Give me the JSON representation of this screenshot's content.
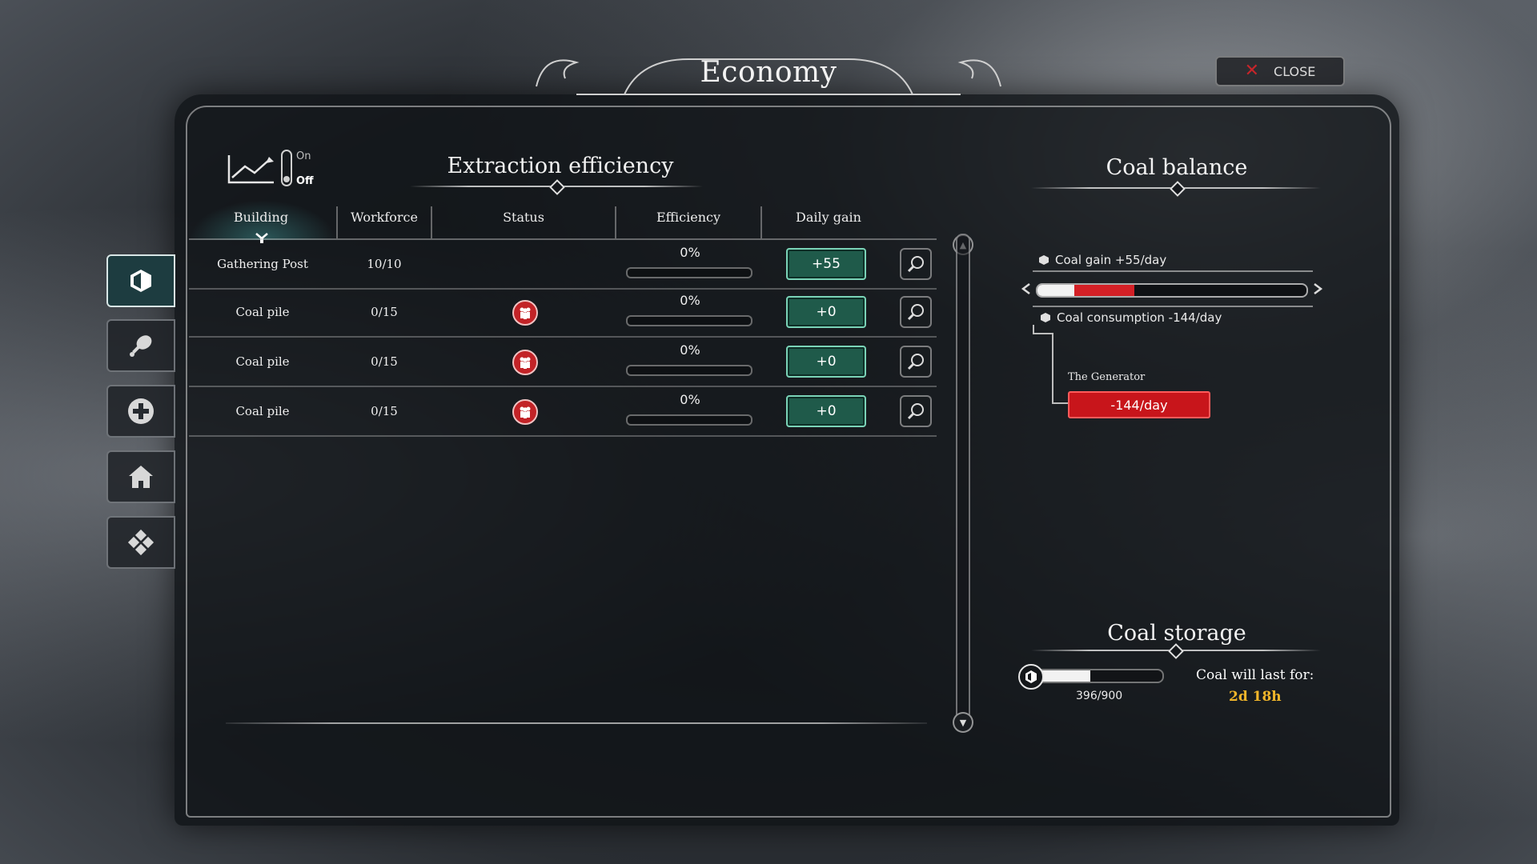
{
  "window": {
    "title": "Economy",
    "close_label": "CLOSE"
  },
  "side_tabs": [
    {
      "icon": "coal-icon",
      "active": true
    },
    {
      "icon": "meat-icon",
      "active": false
    },
    {
      "icon": "health-icon",
      "active": false
    },
    {
      "icon": "house-icon",
      "active": false
    },
    {
      "icon": "resources-icon",
      "active": false
    }
  ],
  "graph_toggle": {
    "on_label": "On",
    "off_label": "Off",
    "state": "off"
  },
  "extraction": {
    "title": "Extraction efficiency",
    "columns": [
      "Building",
      "Workforce",
      "Status",
      "Efficiency",
      "Daily gain"
    ],
    "rows": [
      {
        "building": "Gathering Post",
        "workforce": "10/10",
        "status": "",
        "efficiency": "0%",
        "efficiency_fraction": 0,
        "daily_gain": "+55"
      },
      {
        "building": "Coal pile",
        "workforce": "0/15",
        "status": "no-workers",
        "efficiency": "0%",
        "efficiency_fraction": 0,
        "daily_gain": "+0"
      },
      {
        "building": "Coal pile",
        "workforce": "0/15",
        "status": "no-workers",
        "efficiency": "0%",
        "efficiency_fraction": 0,
        "daily_gain": "+0"
      },
      {
        "building": "Coal pile",
        "workforce": "0/15",
        "status": "no-workers",
        "efficiency": "0%",
        "efficiency_fraction": 0,
        "daily_gain": "+0"
      }
    ]
  },
  "coal_balance": {
    "title": "Coal balance",
    "gain_label": "Coal gain +55/day",
    "consumption_label": "Coal consumption -144/day",
    "gain_per_day": 55,
    "consumption_per_day": 144,
    "consumers": [
      {
        "name": "The Generator",
        "value": "-144/day"
      }
    ]
  },
  "coal_storage": {
    "title": "Coal storage",
    "amount_label": "396/900",
    "fill_fraction": 0.44,
    "last_label": "Coal will last for:",
    "last_value": "2d 18h"
  },
  "colors": {
    "accent_teal": "#1f5a4a",
    "alert_red": "#c8151b",
    "highlight_gold": "#f0b52a"
  }
}
